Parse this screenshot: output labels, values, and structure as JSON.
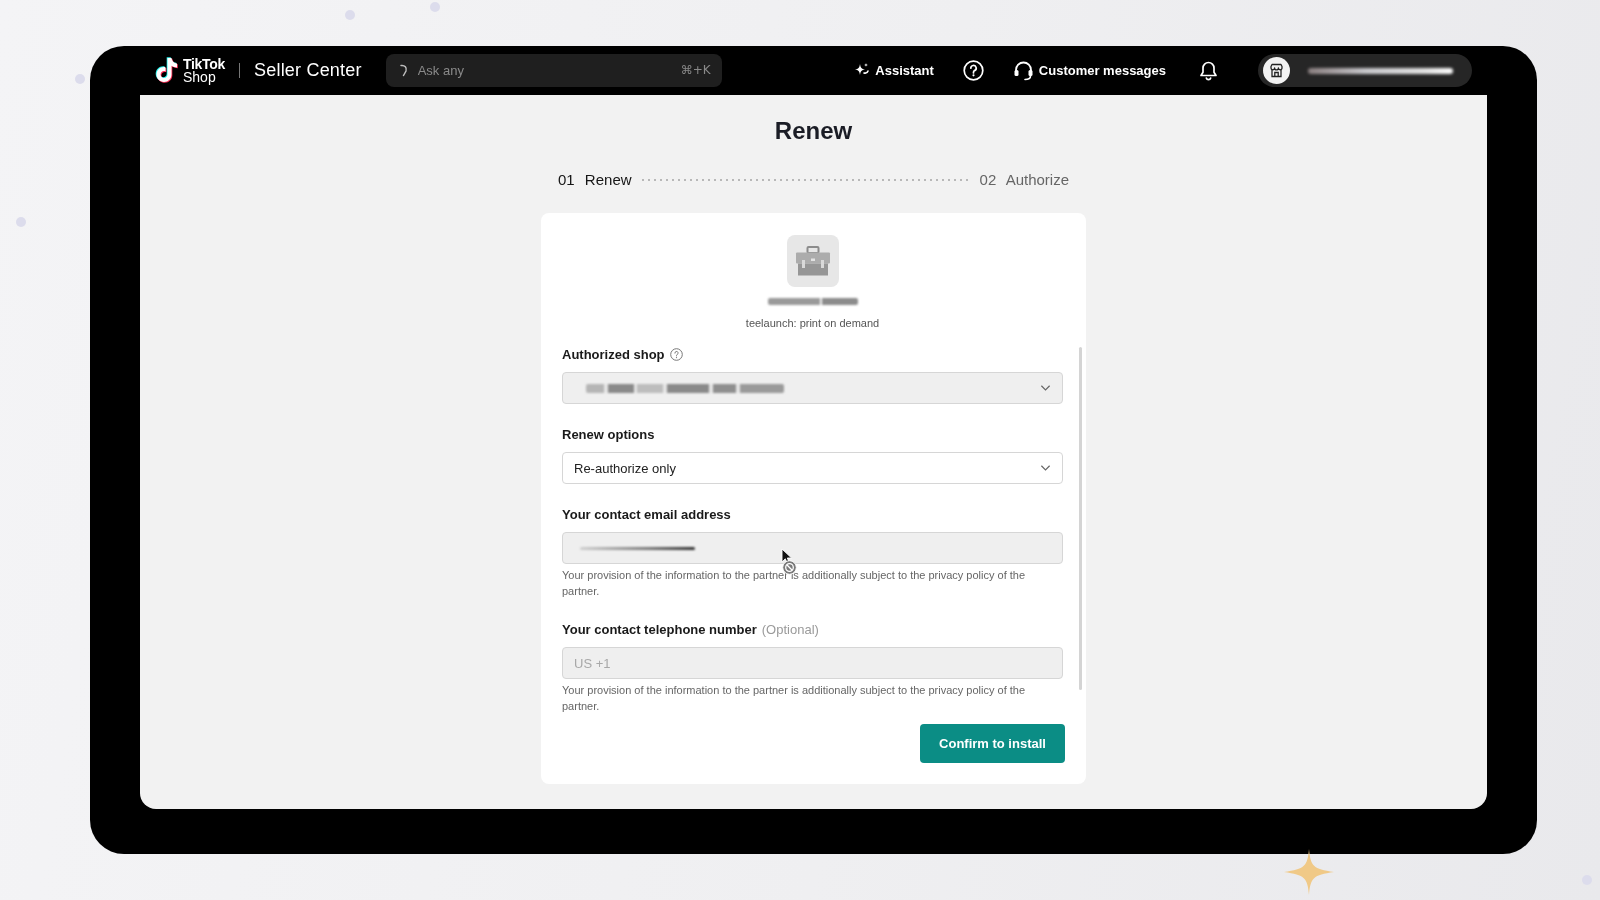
{
  "top_bar": {
    "logo": {
      "wordmark": "TikTok",
      "sub_wordmark": "Shop"
    },
    "product": "Seller Center",
    "search": {
      "placeholder": "Ask any",
      "shortcut": "⌘+K"
    },
    "actions": [
      {
        "kind": "assistant",
        "label": "Assistant"
      },
      {
        "kind": "help"
      },
      {
        "kind": "messages",
        "label": "Customer messages"
      },
      {
        "kind": "notifications"
      }
    ]
  },
  "page": {
    "title": "Renew",
    "steps": [
      {
        "number": "01",
        "label": "Renew",
        "selected": true
      },
      {
        "number": "02",
        "label": "Authorize",
        "selected": false
      }
    ],
    "app": {
      "name": "teelaunch: print on demand"
    },
    "fields": [
      {
        "kind": "select",
        "label": "Authorized shop",
        "help": true,
        "disabled": true,
        "value_hidden": true
      },
      {
        "kind": "select",
        "label": "Renew options",
        "help": false,
        "disabled": false,
        "value_hidden": false,
        "value": "Re-authorize only"
      },
      {
        "kind": "input",
        "label": "Your contact email address",
        "help": false,
        "disabled": true,
        "value_hidden": true,
        "note": "Your provision of the information to the partner is additionally subject to the privacy policy of the partner."
      },
      {
        "kind": "input",
        "label": "Your contact telephone number",
        "optional": "(Optional)",
        "help": false,
        "disabled": true,
        "value_hidden": false,
        "placeholder": "US +1",
        "note": "Your provision of the information to the partner is additionally subject to the privacy policy of the partner."
      }
    ],
    "submit": {
      "label": "Confirm to install"
    }
  }
}
